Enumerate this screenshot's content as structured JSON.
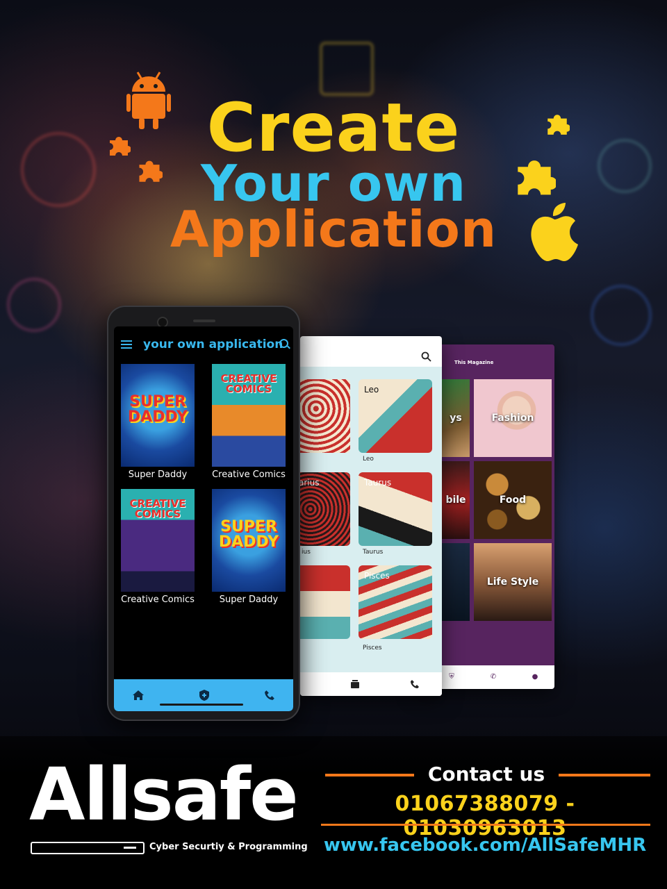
{
  "headline": {
    "line1": "Create",
    "line2": "Your own",
    "line3": "Application"
  },
  "colors": {
    "yellow": "#fbd21c",
    "cyan": "#37c6ef",
    "orange": "#f4781a",
    "purple": "#57245f",
    "blue_nav": "#3fb4f0"
  },
  "phone_main": {
    "title": "your own application",
    "comics": [
      {
        "label": "Super Daddy",
        "cover": "SUPER DADDY"
      },
      {
        "label": "Creative Comics",
        "cover": "CREATIVE COMICS"
      },
      {
        "label": "Creative Comics",
        "cover": "CREATIVE COMICS"
      },
      {
        "label": "Super Daddy",
        "cover": "SUPER DADDY"
      }
    ],
    "nav_icons": [
      "home-icon",
      "shield-icon",
      "phone-icon"
    ]
  },
  "phone_zodiac": {
    "cards": [
      {
        "tag": "",
        "label": ""
      },
      {
        "tag": "Leo",
        "label": "Leo"
      },
      {
        "tag": "arius",
        "label": "ius"
      },
      {
        "tag": "Taurus",
        "label": "Taurus"
      },
      {
        "tag": "",
        "label": ""
      },
      {
        "tag": "Pisces",
        "label": "Pisces"
      }
    ],
    "nav_icons": [
      "layers-icon",
      "phone-icon"
    ]
  },
  "phone_magazine": {
    "title": "This Magazine",
    "tiles": [
      "ys",
      "Fashion",
      "bile",
      "Food",
      "",
      "Life Style"
    ],
    "nav_icons": [
      "shield-icon",
      "phone-icon",
      "user-icon"
    ]
  },
  "footer": {
    "brand": "Allsafe",
    "tagline": "Cyber Securtiy & Programming",
    "contact_title": "Contact us",
    "phones": "01067388079 - 01030963013",
    "facebook": "www.facebook.com/AllSafeMHR"
  }
}
